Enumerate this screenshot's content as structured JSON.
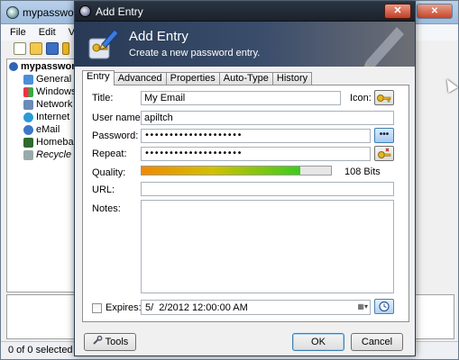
{
  "main_window": {
    "title": "mypasswords.kdbx",
    "menu": [
      "File",
      "Edit",
      "V"
    ],
    "tree": {
      "root": "mypasswords",
      "items": [
        "General",
        "Windows",
        "Network",
        "Internet",
        "eMail",
        "Homebanking",
        "Recycle Bin"
      ]
    },
    "status": "0 of 0 selected",
    "controls": {
      "minimize": "–",
      "maximize": "□",
      "close": "✕"
    }
  },
  "dialog": {
    "title": "Add Entry",
    "close": "✕",
    "banner": {
      "title": "Add Entry",
      "subtitle": "Create a new password entry."
    },
    "tabs": [
      "Entry",
      "Advanced",
      "Properties",
      "Auto-Type",
      "History"
    ],
    "active_tab": "Entry",
    "fields": {
      "title_label": "Title:",
      "title_value": "My Email",
      "icon_label": "Icon:",
      "username_label": "User name:",
      "username_value": "apiltch",
      "password_label": "Password:",
      "password_value": "••••••••••••••••••••",
      "repeat_label": "Repeat:",
      "repeat_value": "••••••••••••••••••••",
      "quality_label": "Quality:",
      "quality_fraction": 0.84,
      "quality_bits": "108 Bits",
      "url_label": "URL:",
      "url_value": "",
      "notes_label": "Notes:",
      "notes_value": "",
      "expires_label": "Expires:",
      "expires_checked": false,
      "expires_value": "5/  2/2012 12:00:00 AM",
      "toggle_password_glyph": "•••"
    },
    "buttons": {
      "tools": "Tools",
      "ok": "OK",
      "cancel": "Cancel"
    }
  },
  "colors": {
    "banner_bg": "#283a55",
    "quality_low": "#f08a00",
    "quality_high": "#3ccc1c",
    "dialog_titlebar": "#1b222c"
  }
}
